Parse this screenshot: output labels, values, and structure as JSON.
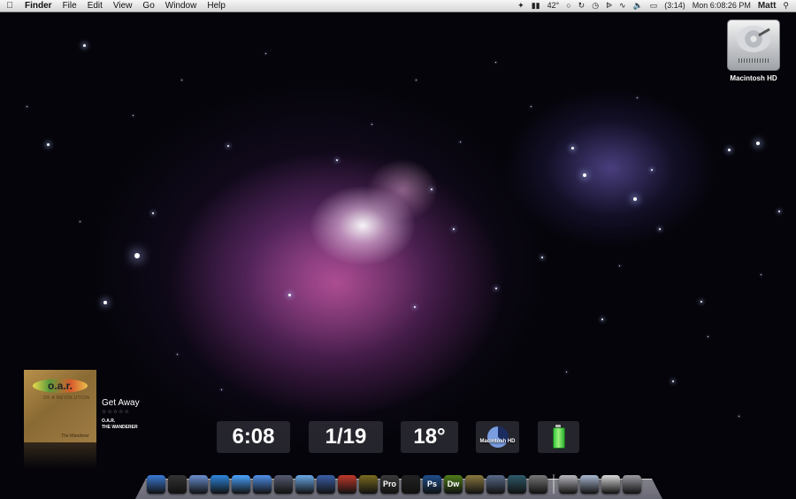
{
  "menubar": {
    "apple_icon": "apple-icon",
    "app_name": "Finder",
    "menus": [
      "File",
      "Edit",
      "View",
      "Go",
      "Window",
      "Help"
    ],
    "status": {
      "temperature": "42°",
      "battery": "(3:14)",
      "clock": "Mon 6:08:26 PM",
      "user": "Matt"
    }
  },
  "desktop": {
    "drive_label": "Macintosh HD"
  },
  "now_playing": {
    "album_art_text": "o.a.r.",
    "album_art_subtext": "OF A REVOLUTION",
    "album_art_foot": "The Wanderer",
    "title": "Get Away",
    "rating_stars": "☆☆☆☆☆",
    "artist": "O.A.R.",
    "album": "THE WANDERER"
  },
  "widgets": {
    "time": "6:08",
    "date": "1/19",
    "temperature": "18°",
    "disk_label": "Macintosh HD",
    "disk_used_fraction": 0.35
  },
  "dock": {
    "items": [
      {
        "name": "finder",
        "label": "",
        "color": "#3a7bd5"
      },
      {
        "name": "dashboard",
        "label": "",
        "color": "#333333"
      },
      {
        "name": "mail",
        "label": "",
        "color": "#6a8fd0"
      },
      {
        "name": "safari",
        "label": "",
        "color": "#2e86de"
      },
      {
        "name": "ichat",
        "label": "",
        "color": "#4aa3ff"
      },
      {
        "name": "itunes",
        "label": "",
        "color": "#4f8fe8"
      },
      {
        "name": "xcode",
        "label": "",
        "color": "#555a70"
      },
      {
        "name": "stacks",
        "label": "",
        "color": "#6aa9e8"
      },
      {
        "name": "front-row",
        "label": "",
        "color": "#3b5fa8"
      },
      {
        "name": "photo-booth",
        "label": "",
        "color": "#c0392b"
      },
      {
        "name": "star-app",
        "label": "",
        "color": "#7a6a20"
      },
      {
        "name": "pro-app",
        "label": "Pro",
        "color": "#3a3a3a"
      },
      {
        "name": "aperture",
        "label": "",
        "color": "#222222"
      },
      {
        "name": "photoshop",
        "label": "Ps",
        "color": "#1d4e8c"
      },
      {
        "name": "dreamweaver",
        "label": "Dw",
        "color": "#4f7d1a"
      },
      {
        "name": "delivery",
        "label": "",
        "color": "#8a7a40"
      },
      {
        "name": "spaces",
        "label": "",
        "color": "#5a6a8a"
      },
      {
        "name": "time-machine",
        "label": "",
        "color": "#2d5a6a"
      },
      {
        "name": "system-prefs",
        "label": "",
        "color": "#777777"
      },
      {
        "name": "separator",
        "label": "",
        "color": ""
      },
      {
        "name": "applications-stack",
        "label": "",
        "color": "#b8b8c0"
      },
      {
        "name": "documents-stack",
        "label": "",
        "color": "#a8b8d0"
      },
      {
        "name": "downloads-stack",
        "label": "",
        "color": "#d8d8d8"
      },
      {
        "name": "trash",
        "label": "",
        "color": "#9a9aa2"
      }
    ]
  }
}
